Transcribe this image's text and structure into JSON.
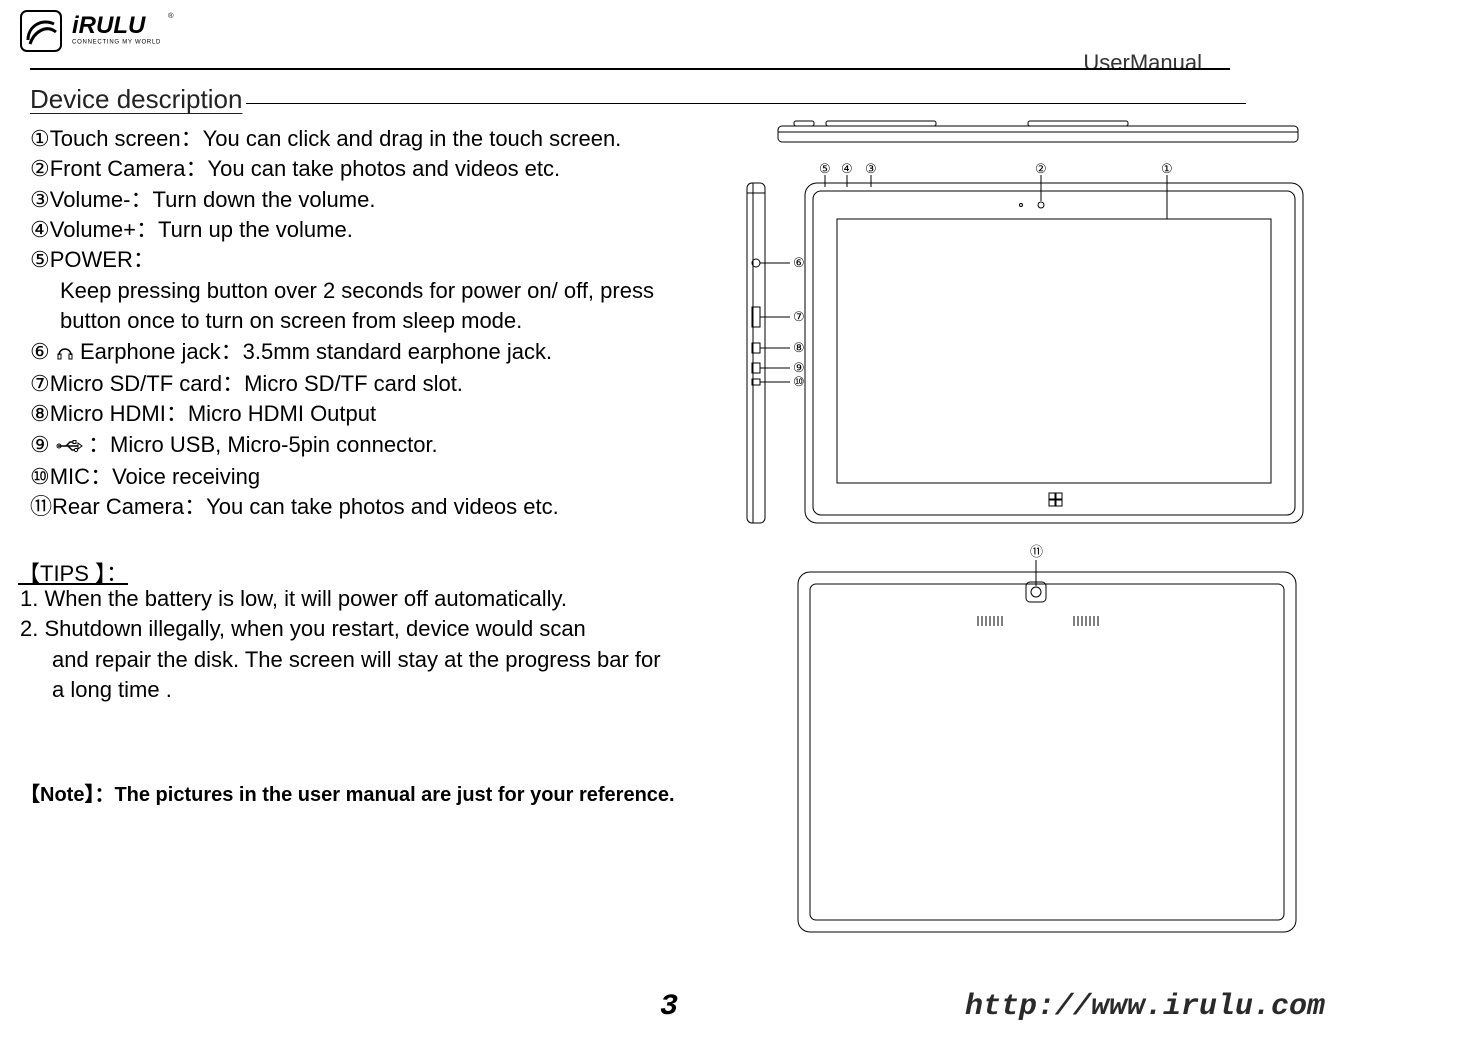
{
  "header": {
    "brand_word": "iRULU",
    "brand_tag": "CONNECTING MY WORLD",
    "doc_title": "UserManual"
  },
  "section_title": "Device description",
  "features": [
    {
      "num": "①",
      "label": "Touch screen",
      "sep": "：",
      "desc": "You can click and drag in the touch screen."
    },
    {
      "num": "②",
      "label": "Front Camera",
      "sep": "：",
      "desc": "You can take photos and videos etc."
    },
    {
      "num": "③",
      "label": "Volume-",
      "sep": "：",
      "desc": "Turn down the volume."
    },
    {
      "num": "④",
      "label": "Volume+",
      "sep": "：",
      "desc": "Turn up the volume."
    },
    {
      "num": "⑤",
      "label": "POWER",
      "sep": "：",
      "desc": "",
      "extra": [
        "Keep pressing button over 2 seconds for power on/ off, press",
        "button once to turn on screen from sleep mode."
      ]
    },
    {
      "num": "⑥",
      "icon": "earphone",
      "label": " Earphone jack",
      "sep": "：",
      "desc": "3.5mm standard earphone jack."
    },
    {
      "num": "⑦",
      "label": "Micro SD/TF card",
      "sep": "：",
      "desc": "Micro SD/TF card slot."
    },
    {
      "num": "⑧",
      "label": "Micro HDMI",
      "sep": "：",
      "desc": "Micro HDMI Output"
    },
    {
      "num": "⑨",
      "icon": "usb",
      "label": " ",
      "sep": "：",
      "desc": "Micro USB, Micro-5pin connector."
    },
    {
      "num": "⑩",
      "label": "MIC",
      "sep": "：",
      "desc": "Voice receiving"
    },
    {
      "num": "⑪",
      "label": "Rear Camera",
      "sep": "：",
      "desc": "You can take photos and videos etc."
    }
  ],
  "tips": {
    "heading": "【TIPS 】：",
    "lines": [
      "1. When the battery is low, it will power off automatically.",
      "2. Shutdown illegally, when you restart, device would scan"
    ],
    "indents": [
      "and repair the disk. The screen will stay at the progress bar for",
      "a long time ."
    ]
  },
  "note": "【Note】：The pictures in the user manual are just for your reference.",
  "callouts": {
    "one": "①",
    "two": "②",
    "three": "③",
    "four": "④",
    "five": "⑤",
    "six": "⑥",
    "seven": "⑦",
    "eight": "⑧",
    "nine": "⑨",
    "ten": "⑩",
    "eleven": "⑪"
  },
  "footer": {
    "page": "3",
    "url": "http://www.irulu.com"
  }
}
